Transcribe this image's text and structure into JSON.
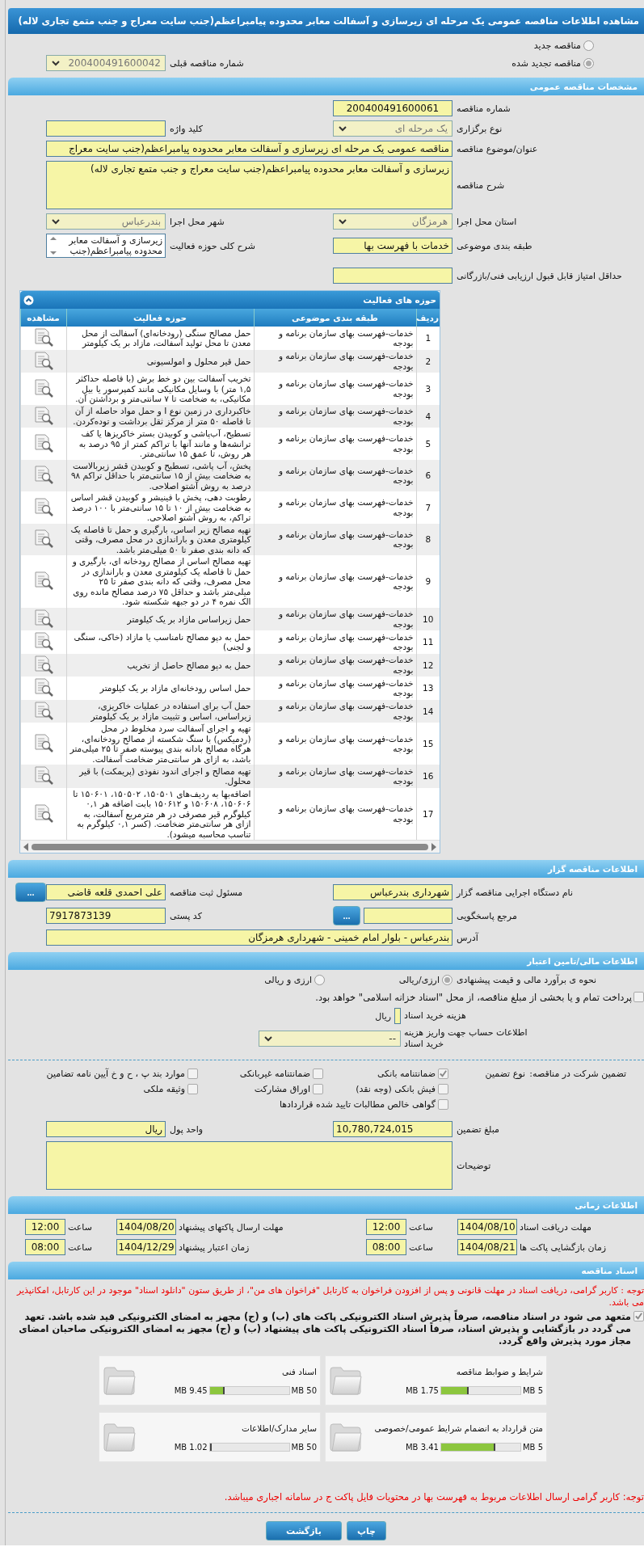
{
  "page_header": {
    "title": "مشاهده اطلاعات مناقصه عمومی یک مرحله ای زیرسازی و آسفالت معابر محدوده پیامبراعظم(جنب سایت معراج و جنب متمع تجاری لاله)"
  },
  "tender_kind": [
    {
      "label": "مناقصه جدید",
      "selected": false
    },
    {
      "label": "مناقصه تجدید شده",
      "selected": true
    }
  ],
  "previous_tender": {
    "label": "شماره مناقصه قبلی",
    "value": "200400491600042"
  },
  "general_info": {
    "title": "مشخصات مناقصه عمومی",
    "tender_number": {
      "label": "شماره مناقصه",
      "value": "200400491600061"
    },
    "holding_type": {
      "label": "نوع برگزاری",
      "value": "یک مرحله ای"
    },
    "keyword": {
      "label": "کلید واژه"
    },
    "subject": {
      "label": "عنوان/موضوع مناقصه",
      "value": "مناقصه عمومی یک مرحله ای زیرسازی و آسفالت معابر محدوده پیامبراعظم(جنب سایت معراج"
    },
    "description": {
      "label": "شرح مناقصه",
      "value": "زیرسازی و آسفالت معابر محدوده پیامبراعظم(جنب سایت معراج و جنب متمع تجاری لاله)"
    },
    "province": {
      "label": "استان محل اجرا",
      "value": "هرمزگان"
    },
    "city": {
      "label": "شهر محل اجرا",
      "value": "بندرعباس"
    },
    "category": {
      "label": "طبقه بندی موضوعی",
      "value": "خدمات با فهرست بها"
    },
    "activity_scope": {
      "label": "شرح کلی حوزه فعالیت",
      "value": "زیرسازی و آسفالت معابر محدوده پیامبراعظم(جنب"
    },
    "min_score": {
      "label": "حداقل امتیاز قابل قبول ارزیابی فنی/بازرگانی"
    }
  },
  "activities": {
    "title": "حوزه های فعالیت",
    "columns": [
      "ردیف",
      "طبقه بندی موضوعی",
      "حوزه فعالیت",
      "مشاهده"
    ],
    "rows": [
      {
        "index": "1",
        "category": "خدمات-فهرست بهای سازمان برنامه و بودجه",
        "activity": "حمل مصالح سنگی (رودخانه‌ای) آسفالت از محل معدن تا محل تولید آسفالت، مازاد بر یک کیلومتر"
      },
      {
        "index": "2",
        "category": "خدمات-فهرست بهای سازمان برنامه و بودجه",
        "activity": "حمل قیر محلول و امولسیونی"
      },
      {
        "index": "3",
        "category": "خدمات-فهرست بهای سازمان برنامه و بودجه",
        "activity": "تخریب آسفالت بین دو خط برش (با فاصله حداکثر ۱,۵ متر) با وسایل مکانیکی مانند کمپرسور یا بیل مکانیکی، به ضخامت تا ۷ سانتی‌متر و برداشتن آن."
      },
      {
        "index": "4",
        "category": "خدمات-فهرست بهای سازمان برنامه و بودجه",
        "activity": "خاکبرداری در زمین نوع I و حمل مواد حاصله از آن تا فاصله ۵۰ متر از مرکز ثقل برداشت و توده‌کردن."
      },
      {
        "index": "5",
        "category": "خدمات-فهرست بهای سازمان برنامه و بودجه",
        "activity": "تسطیح، آب‌پاشی و کوبیدن بستر خاکریزها یا کف ترانشه‌ها و مانند آنها با تراکم کمتر از ۹۵ درصد به هر روش، تا عمق ۱۵ سانتی‌متر."
      },
      {
        "index": "6",
        "category": "خدمات-فهرست بهای سازمان برنامه و بودجه",
        "activity": "پخش، آب پاشی، تسطیح و کوبیدن قشر زیربالاست به ضخامت بیش از ۱۵ سانتی‌متر با حداقل تراکم ۹۸ درصد به روش آشتو اصلاحی."
      },
      {
        "index": "7",
        "category": "خدمات-فهرست بهای سازمان برنامه و بودجه",
        "activity": "رطوبت دهی، پخش با فینیشر و کوبیدن قشر اساس به ضخامت بیش از ۱۰ تا ۱۵ سانتی‌متر با ۱۰۰ درصد تراکم، به روش آشتو اصلاحی."
      },
      {
        "index": "8",
        "category": "خدمات-فهرست بهای سازمان برنامه و بودجه",
        "activity": "تهیه مصالح زیر اساس، بارگیری و حمل تا فاصله یک کیلومتری معدن و باراندازی در محل مصرف، وقتی که دانه بندی صفر تا ۵۰ میلی‌متر باشد."
      },
      {
        "index": "9",
        "category": "خدمات-فهرست بهای سازمان برنامه و بودجه",
        "activity": "تهیه مصالح اساس از مصالح رودخانه ای، بارگیری و حمل تا فاصله یک کیلومتری معدن و باراندازی در محل مصرف، وقتی که دانه بندی صفر تا ۲۵ میلی‌متر باشد و حداقل ۷۵ درصد مصالح مانده روی الک نمره ۴ در دو جبهه شکسته شود."
      },
      {
        "index": "10",
        "category": "خدمات-فهرست بهای سازمان برنامه و بودجه",
        "activity": "حمل زیراساس مازاد بر یک کیلومتر"
      },
      {
        "index": "11",
        "category": "خدمات-فهرست بهای سازمان برنامه و بودجه",
        "activity": "حمل به دپو مصالح نامناسب یا مازاد (خاکی، سنگی و لجنی)"
      },
      {
        "index": "12",
        "category": "خدمات-فهرست بهای سازمان برنامه و بودجه",
        "activity": "حمل به دپو مصالح حاصل از تخریب"
      },
      {
        "index": "13",
        "category": "خدمات-فهرست بهای سازمان برنامه و بودجه",
        "activity": "حمل اساس رودخانه‌ای مازاد بر یک کیلومتر"
      },
      {
        "index": "14",
        "category": "خدمات-فهرست بهای سازمان برنامه و بودجه",
        "activity": "حمل آب برای استفاده در عملیات خاکریزی، زیراساس، اساس و تثبیت مازاد بر یک کیلومتر"
      },
      {
        "index": "15",
        "category": "خدمات-فهرست بهای سازمان برنامه و بودجه",
        "activity": "تهیه و اجرای آسفالت سرد مخلوط در محل (ردمیکس) با سنگ شکسته از مصالح رودخانه‌ای، هرگاه مصالح بادانه بندی پیوسته صفر تا ۲۵ میلی‌متر باشد، به ازای هر سانتی‌متر ضخامت آسفالت."
      },
      {
        "index": "16",
        "category": "خدمات-فهرست بهای سازمان برنامه و بودجه",
        "activity": "تهیه مصالح و اجرای اندود نفوذی (پریمکت) با قیر محلول."
      },
      {
        "index": "17",
        "category": "خدمات-فهرست بهای سازمان برنامه و بودجه",
        "activity": "اضافه‌بها به ردیف‌های ۱۵۰۵۰۱، ۱۵۰۵۰۲، ۱۵۰۶۰۱ تا ۱۵۰۶۰۶، ۱۵۰۶۰۸ و ۱۵۰۶۱۲ بابت اضافه هر ۰,۱ کیلوگرم قیر مصرفی در هر مترمربع آسفالت، به ازای هر سانتی‌متر ضخامت. (کسر ۰,۱ کیلوگرم به تناسب محاسبه میشود)."
      }
    ]
  },
  "tenderer": {
    "title": "اطلاعات مناقصه گزار",
    "organization": {
      "label": "نام دستگاه اجرایی مناقصه گزار",
      "value": "شهرداری بندرعباس"
    },
    "registrar": {
      "label": "مسئول ثبت مناقصه",
      "value": "علی احمدی قلعه قاضی",
      "button": "..."
    },
    "response_ref": {
      "label": "مرجع پاسخگویی",
      "button": "..."
    },
    "postal_code": {
      "label": "کد پستی",
      "value": "7917873139"
    },
    "address": {
      "label": "آدرس",
      "value": "بندرعباس - بلوار امام خمینی - شهرداری هرمزگان"
    }
  },
  "financial": {
    "title": "اطلاعات مالی/تامین اعتبار",
    "estimate_label": "نحوه ی برآورد مالی و قیمت پیشنهادی",
    "currency_options": [
      {
        "label": "ارزی/ریالی",
        "selected": true
      },
      {
        "label": "ارزی و ریالی",
        "selected": false
      }
    ],
    "treasury": {
      "label": "پرداخت تمام و یا بخشی از مبلغ مناقصه، از محل \"اسناد خزانه اسلامی\" خواهد بود.",
      "checked": false
    },
    "doc_cost": {
      "label": "هزینه خرید اسناد",
      "unit": "ریال"
    },
    "account": {
      "label": "اطلاعات حساب جهت واریز هزینه خرید اسناد",
      "value": "--"
    }
  },
  "guarantee": {
    "label": "تضمین شرکت در مناقصه:",
    "type_label": "نوع تضمین",
    "options": [
      {
        "label": "ضمانتنامه بانکی",
        "checked": true
      },
      {
        "label": "ضمانتنامه غیربانکی",
        "checked": false
      },
      {
        "label": "موارد بند پ ، ح و خ آیین نامه تضامین",
        "checked": false
      },
      {
        "label": "فیش بانکی (وجه نقد)",
        "checked": false
      },
      {
        "label": "اوراق مشارکت",
        "checked": false
      },
      {
        "label": "وثیقه ملکی",
        "checked": false
      },
      {
        "label": "گواهی خالص مطالبات تایید شده قراردادها",
        "checked": false
      }
    ],
    "amount": {
      "label": "مبلغ تضمین",
      "value": "10,780,724,015"
    },
    "currency": {
      "label": "واحد پول",
      "value": "ریال"
    },
    "notes": {
      "label": "توضیحات"
    }
  },
  "schedule": {
    "title": "اطلاعات زمانی",
    "items": [
      {
        "label": "مهلت دریافت اسناد",
        "date": "1404/08/10",
        "time_label": "ساعت",
        "time": "12:00"
      },
      {
        "label": "مهلت ارسال پاکتهای پیشنهاد",
        "date": "1404/08/20",
        "time_label": "ساعت",
        "time": "12:00"
      },
      {
        "label": "زمان بازگشایی پاکت ها",
        "date": "1404/08/21",
        "time_label": "ساعت",
        "time": "08:00"
      },
      {
        "label": "زمان اعتبار پیشنهاد",
        "date": "1404/12/29",
        "time_label": "ساعت",
        "time": "08:00"
      }
    ]
  },
  "documents": {
    "title": "اسناد مناقصه",
    "notice": "توجه : کاربر گرامی، دریافت اسناد در مهلت قانونی و پس از افزودن فراخوان به کارتابل \"فراخوان های من\"، از طریق ستون \"دانلود اسناد\" موجود در این کارتابل، امکانپذیر می باشد.",
    "commitment": {
      "text": "متعهد می شود در اسناد مناقصه، صرفاً پذیرش اسناد الکترونیکی پاکت های (ب) و (ج) مجهز به امضای الکترونیکی قید شده باشد. تعهد می گردد در بازگشایی و پذیرش اسناد، صرفاً اسناد الکترونیکی پاکت های پیشنهاد (ب) و (ج) مجهز به امضای الکترونیکی صاحبان امضای مجاز مورد پذیرش واقع گردد.",
      "checked": true
    },
    "files": [
      {
        "title": "شرایط و ضوابط مناقصه",
        "used": "1.75 MB",
        "max": "5 MB",
        "level": 0.35
      },
      {
        "title": "اسناد فنی",
        "used": "9.45 MB",
        "max": "50 MB",
        "level": 0.189
      },
      {
        "title": "متن قرارداد به انضمام شرایط عمومی/خصوصی",
        "used": "3.41 MB",
        "max": "5 MB",
        "level": 0.682
      },
      {
        "title": "سایر مدارک/اطلاعات",
        "used": "1.02 MB",
        "max": "50 MB",
        "level": 0.02
      }
    ]
  },
  "footer_notice": "توجه: کاربر گرامی ارسال اطلاعات مربوط به فهرست بها در محتویات فایل پاکت ج در سامانه اجباری میباشد.",
  "buttons": [
    "چاپ",
    "بازگشت"
  ]
}
